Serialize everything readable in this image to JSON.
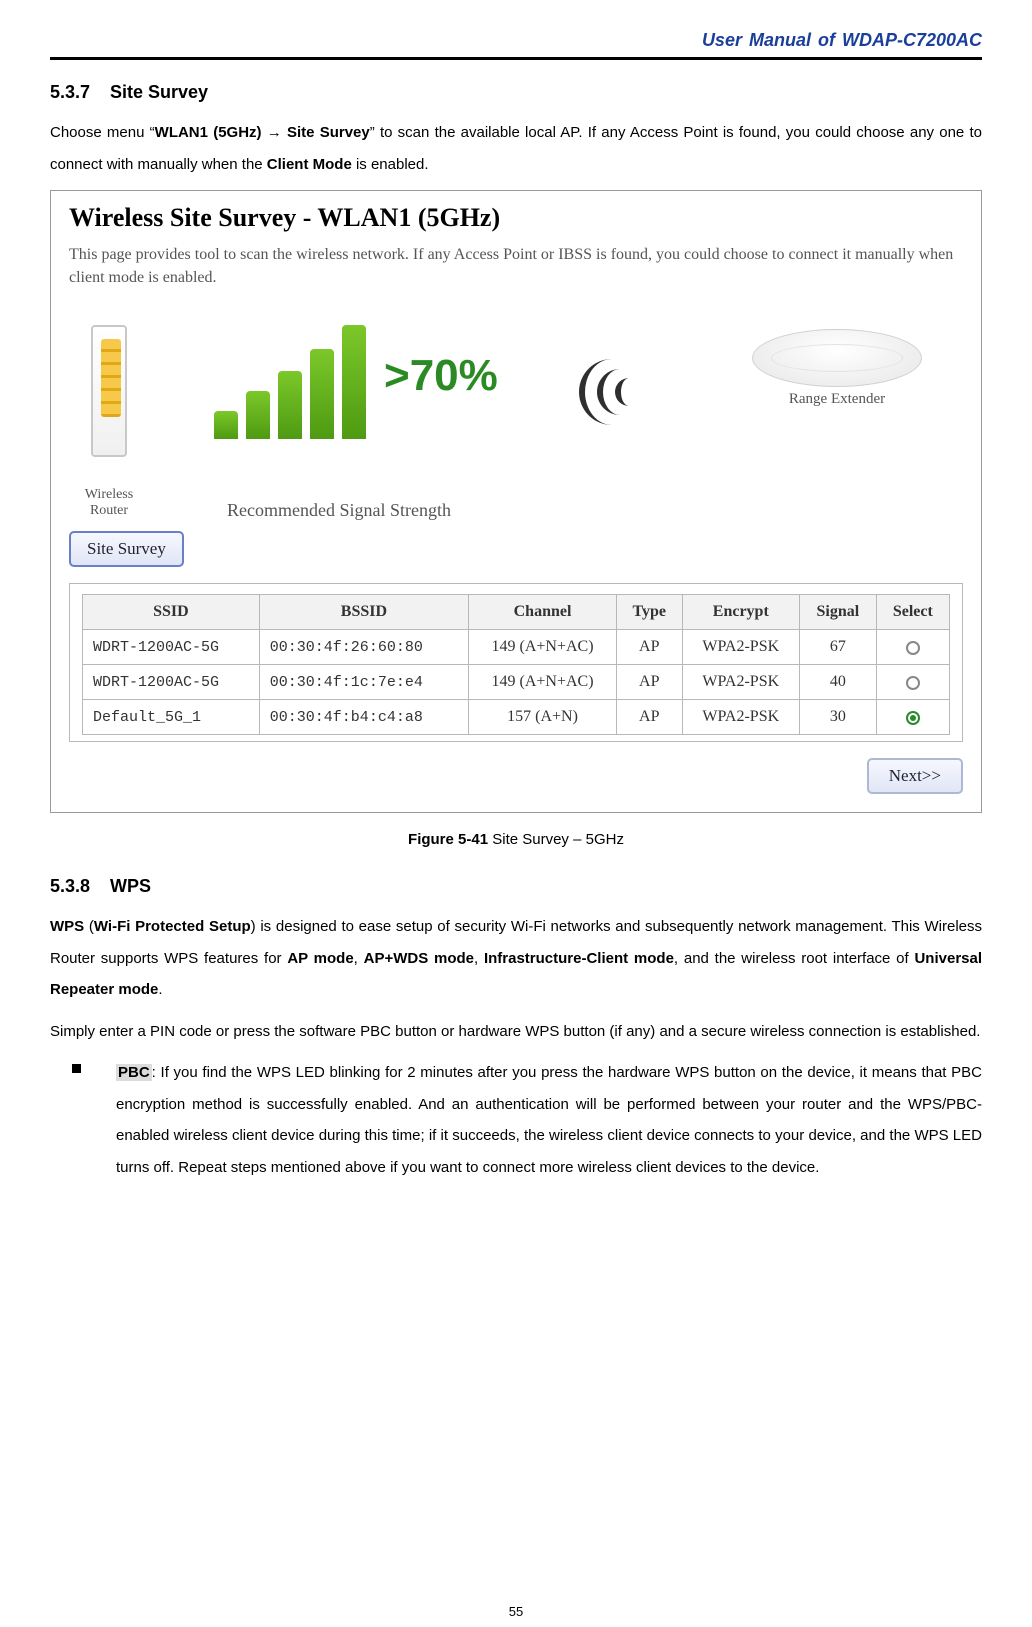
{
  "header": {
    "running_title": "User Manual of WDAP-C7200AC"
  },
  "sec537": {
    "number": "5.3.7",
    "title": "Site Survey",
    "para_a": "Choose menu “",
    "menu_path_a": "WLAN1 (5GHz)",
    "arrow": " → ",
    "menu_path_b": "Site Survey",
    "para_b": "” to scan the available local AP. If any Access Point is found, you could choose any one to connect with manually when the ",
    "client_mode_bold": "Client Mode",
    "para_c": " is enabled."
  },
  "panel": {
    "title": "Wireless Site Survey - WLAN1 (5GHz)",
    "desc": "This page provides tool to scan the wireless network. If any Access Point or IBSS is found, you could choose to connect it manually when client mode is enabled.",
    "router_caption": "Wireless Router",
    "pct_text": ">70%",
    "rec_label": "Recommended Signal Strength",
    "extender_caption": "Range Extender",
    "survey_btn": "Site Survey",
    "next_btn": "Next>>",
    "columns": {
      "ssid": "SSID",
      "bssid": "BSSID",
      "channel": "Channel",
      "type": "Type",
      "encrypt": "Encrypt",
      "signal": "Signal",
      "select": "Select"
    },
    "rows": [
      {
        "ssid": "WDRT-1200AC-5G",
        "bssid": "00:30:4f:26:60:80",
        "channel": "149 (A+N+AC)",
        "type": "AP",
        "encrypt": "WPA2-PSK",
        "signal": "67",
        "selected": false
      },
      {
        "ssid": "WDRT-1200AC-5G",
        "bssid": "00:30:4f:1c:7e:e4",
        "channel": "149 (A+N+AC)",
        "type": "AP",
        "encrypt": "WPA2-PSK",
        "signal": "40",
        "selected": false
      },
      {
        "ssid": "Default_5G_1",
        "bssid": "00:30:4f:b4:c4:a8",
        "channel": "157 (A+N)",
        "type": "AP",
        "encrypt": "WPA2-PSK",
        "signal": "30",
        "selected": true
      }
    ]
  },
  "figure": {
    "label": "Figure 5-41",
    "caption": " Site Survey – 5GHz"
  },
  "sec538": {
    "number": "5.3.8",
    "title": "WPS",
    "p1_a": "WPS",
    "p1_b": " (",
    "p1_c": "Wi-Fi Protected Setup",
    "p1_d": ") is designed to ease setup of security Wi-Fi networks and subsequently network management. This Wireless Router supports WPS features for ",
    "p1_e": "AP mode",
    "p1_f": ", ",
    "p1_g": "AP+WDS mode",
    "p1_h": ", ",
    "p1_i": "Infrastructure-Client mode",
    "p1_j": ", and the wireless root interface of ",
    "p1_k": "Universal Repeater mode",
    "p1_l": ".",
    "p2": "Simply enter a PIN code or press the software PBC button or hardware WPS button (if any) and a secure wireless connection is established.",
    "pbc_label": "PBC",
    "pbc_text": ": If you find the WPS LED blinking for 2 minutes after you press the hardware WPS button on the device, it means that PBC encryption method is successfully enabled. And an authentication will be performed between your router and the WPS/PBC-enabled wireless client device during this time; if it succeeds, the wireless client device connects to your device, and the WPS LED turns off. Repeat steps mentioned above if you want to connect more wireless client devices to the device."
  },
  "page_number": "55"
}
